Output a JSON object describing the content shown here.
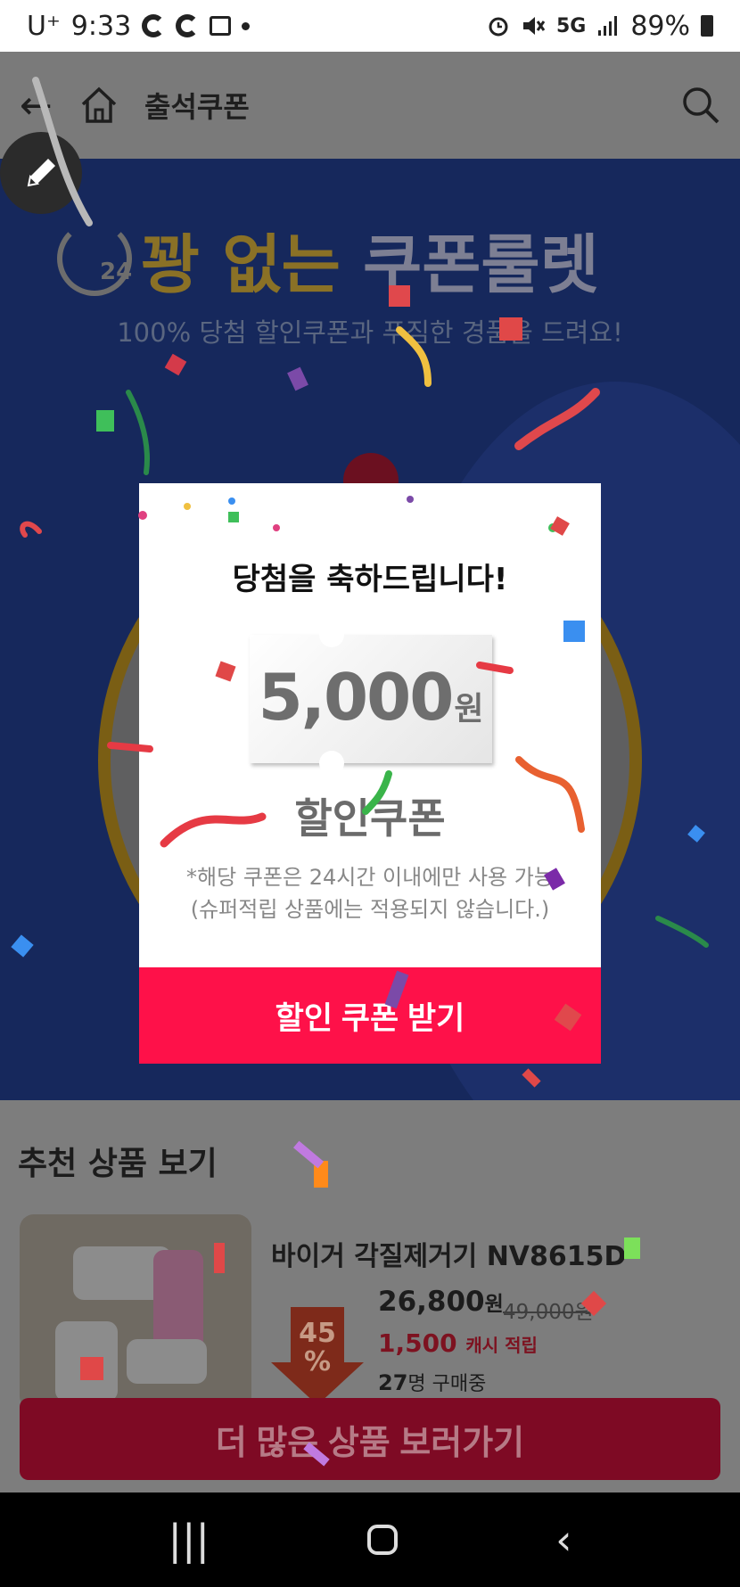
{
  "status_bar": {
    "carrier": "U⁺",
    "time": "9:33",
    "network": "5G",
    "battery": "89%"
  },
  "header": {
    "back_icon": "←",
    "title": "출석쿠폰"
  },
  "hero": {
    "clock_number": "24",
    "title_part1": "꽝 없는",
    "title_part2": "쿠폰룰렛",
    "subtitle": "100% 당첨 할인쿠폰과 푸짐한 경품을 드려요!"
  },
  "modal": {
    "title": "당첨을 축하드립니다!",
    "coupon_amount": "5,000",
    "coupon_unit": "원",
    "coupon_label": "할인쿠폰",
    "notice_line1": "*해당 쿠폰은 24시간 이내에만 사용 가능",
    "notice_line2": "(슈퍼적립 상품에는 적용되지 않습니다.)",
    "cta_label": "할인 쿠폰 받기"
  },
  "recommended": {
    "title": "추천 상품 보기",
    "product": {
      "name": "바이거 각질제거기 NV8615D",
      "price": "26,800",
      "price_unit": "원",
      "original_price": "49,000원",
      "cash_amount": "1,500",
      "cash_label": "캐시 적립",
      "buyers_count": "27",
      "buyers_label": "명 구매중",
      "discount_number": "45",
      "discount_unit": "%"
    }
  },
  "more_button": "더 많은 상품 보러가기",
  "nav": {
    "recents_icon": "|||",
    "back_icon": "‹"
  },
  "colors": {
    "cta": "#fe1149",
    "more_button": "#7e0a24",
    "hero_bg": "#16285c"
  }
}
